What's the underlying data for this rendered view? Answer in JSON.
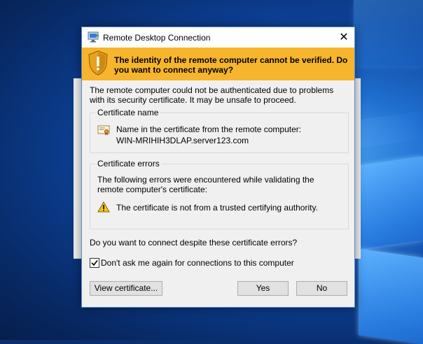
{
  "dialog": {
    "title": "Remote Desktop Connection",
    "close_glyph": "✕",
    "banner_text": "The identity of the remote computer cannot be verified. Do you want to connect anyway?",
    "intro_text": "The remote computer could not be authenticated due to problems with its security certificate. It may be unsafe to proceed.",
    "certificate_name": {
      "group_label": "Certificate name",
      "line1": "Name in the certificate from the remote computer:",
      "line2": "WIN-MRIHIH3DLAP.server123.com"
    },
    "certificate_errors": {
      "group_label": "Certificate errors",
      "description": "The following errors were encountered while validating the remote computer's certificate:",
      "error_item": "The certificate is not from a trusted certifying authority."
    },
    "question": "Do you want to connect despite these certificate errors?",
    "dont_ask_checkbox": {
      "label": "Don't ask me again for connections to this computer",
      "checked": true
    },
    "buttons": {
      "view_certificate": "View certificate...",
      "yes": "Yes",
      "no": "No"
    },
    "colors": {
      "banner": "#f6b52c",
      "dialog_bg": "#f0f0f0",
      "desktop": "#0c3f93"
    },
    "icons": [
      "remote-desktop-icon",
      "warning-shield-icon",
      "certificate-icon",
      "warning-triangle-icon",
      "checkmark-icon",
      "close-icon"
    ]
  }
}
